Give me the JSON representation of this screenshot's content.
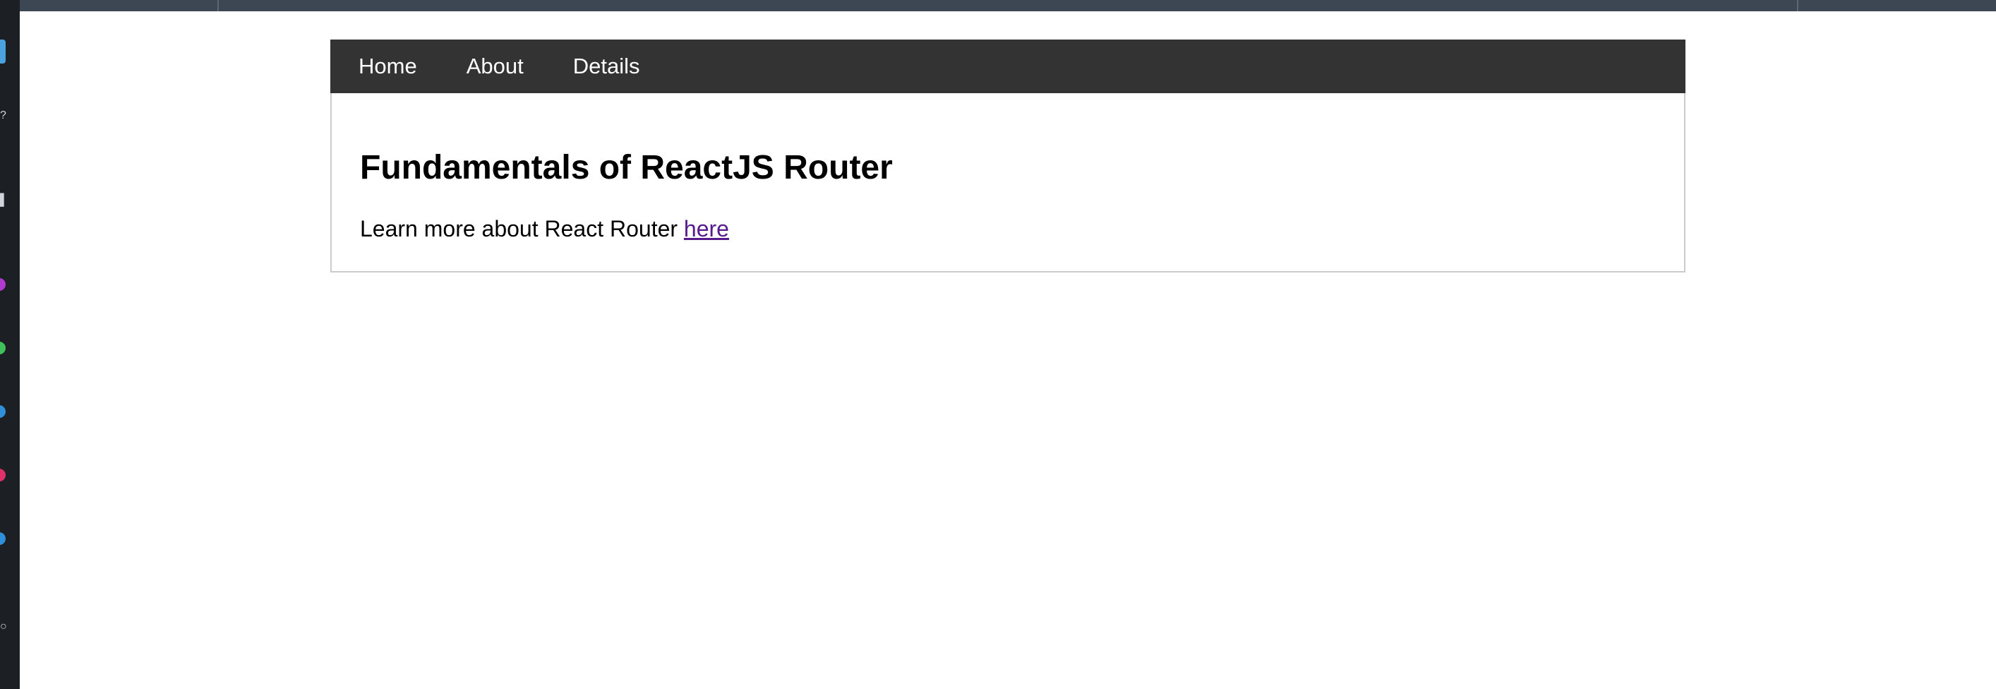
{
  "nav": {
    "items": [
      {
        "label": "Home"
      },
      {
        "label": "About"
      },
      {
        "label": "Details"
      }
    ]
  },
  "main": {
    "title": "Fundamentals of ReactJS Router",
    "lead_text": "Learn more about React Router ",
    "link_text": "here"
  },
  "colors": {
    "navbar_bg": "#333333",
    "link_visited": "#551a8b",
    "dock_bg": "#1c1f24",
    "top_strip": "#3d4653"
  }
}
